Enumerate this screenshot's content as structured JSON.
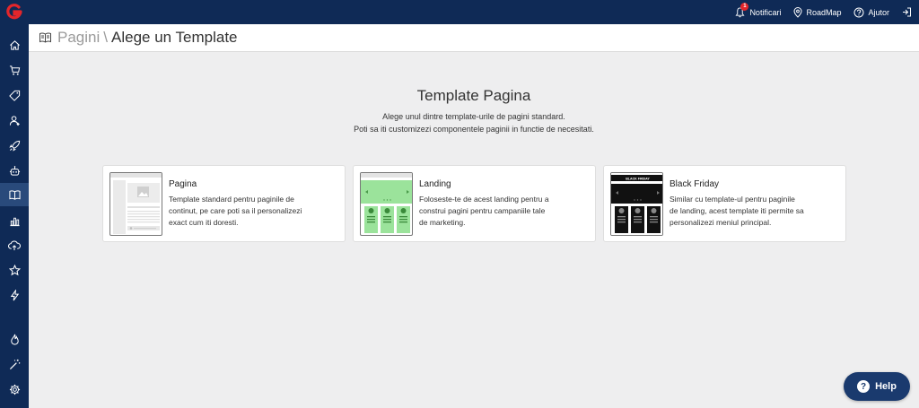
{
  "topbar": {
    "notifications_label": "Notificari",
    "notifications_count": "1",
    "roadmap_label": "RoadMap",
    "help_label": "Ajutor"
  },
  "sidebar": {
    "items": [
      {
        "icon": "home-icon"
      },
      {
        "icon": "cart-icon"
      },
      {
        "icon": "tag-icon"
      },
      {
        "icon": "users-icon"
      },
      {
        "icon": "rocket-icon"
      },
      {
        "icon": "robot-icon"
      },
      {
        "icon": "book-icon",
        "active": true
      },
      {
        "icon": "chart-icon"
      },
      {
        "icon": "cloud-upload-icon"
      },
      {
        "icon": "star-icon"
      },
      {
        "icon": "lightning-icon"
      },
      {
        "icon": "fire-icon"
      },
      {
        "icon": "magic-wand-icon"
      },
      {
        "icon": "gear-icon"
      }
    ]
  },
  "header": {
    "root": "Pagini",
    "separator": "\\",
    "current": "Alege un Template"
  },
  "main": {
    "title": "Template Pagina",
    "subtitle_line1": "Alege unul dintre template-urile de pagini standard.",
    "subtitle_line2": "Poti sa iti customizezi componentele paginii in functie de necesitati."
  },
  "cards": [
    {
      "title": "Pagina",
      "desc": "Template standard pentru paginile de continut, pe care poti sa il personalizezi exact cum iti doresti."
    },
    {
      "title": "Landing",
      "desc": "Foloseste-te de acest landing pentru a construi pagini pentru campaniile tale de marketing."
    },
    {
      "title": "Black Friday",
      "desc": "Similar cu template-ul pentru paginile de landing, acest template iti permite sa personalizezi meniul principal.",
      "thumb_label": "BLACK FRIDAY"
    }
  ],
  "help_button": {
    "label": "Help"
  },
  "colors": {
    "nav_bg": "#0f2a56",
    "nav_active": "#294a7b",
    "landing_green": "#9be39b",
    "badge_red": "#e3262b"
  }
}
